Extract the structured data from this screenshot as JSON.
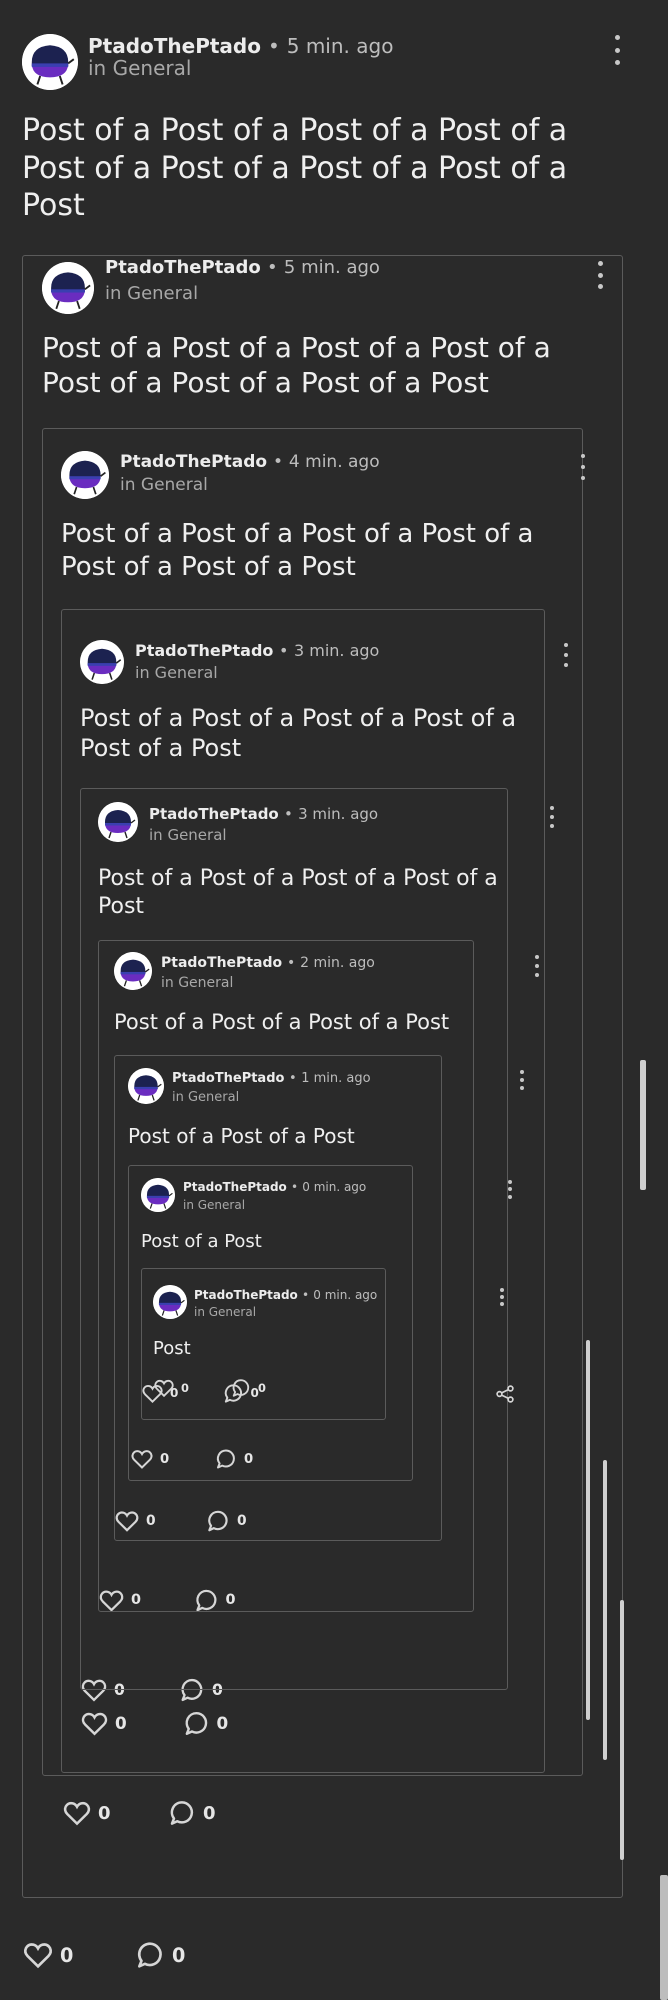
{
  "posts": [
    {
      "username": "PtadoThePtado",
      "separator": "•",
      "time": "5 min. ago",
      "community": "in General",
      "text": "Post of a Post of a Post of a Post of a Post of a Post of a Post of a Post of a Post",
      "likes": "0",
      "comments": "0"
    },
    {
      "username": "PtadoThePtado",
      "separator": "•",
      "time": "5 min. ago",
      "community": "in General",
      "text": "Post of a Post of a Post of a Post of a Post of a Post of a Post of a Post",
      "likes": "0",
      "comments": "0"
    },
    {
      "username": "PtadoThePtado",
      "separator": "•",
      "time": "4 min. ago",
      "community": "in General",
      "text": "Post of a Post of a Post of a Post of a Post of a Post of a Post",
      "likes": "0",
      "comments": "0"
    },
    {
      "username": "PtadoThePtado",
      "separator": "•",
      "time": "3 min. ago",
      "community": "in General",
      "text": "Post of a Post of a Post of a Post of a Post of a Post",
      "likes": "0",
      "comments": "0"
    },
    {
      "username": "PtadoThePtado",
      "separator": "•",
      "time": "3 min. ago",
      "community": "in General",
      "text": "Post of a Post of a Post of a Post of a Post",
      "likes": "0",
      "comments": "0"
    },
    {
      "username": "PtadoThePtado",
      "separator": "•",
      "time": "2 min. ago",
      "community": "in General",
      "text": "Post of a Post of a Post of a Post",
      "likes": "0",
      "comments": "0"
    },
    {
      "username": "PtadoThePtado",
      "separator": "•",
      "time": "1 min. ago",
      "community": "in General",
      "text": "Post of a Post of a Post",
      "likes": "0",
      "comments": "0"
    },
    {
      "username": "PtadoThePtado",
      "separator": "•",
      "time": "0 min. ago",
      "community": "in General",
      "text": "Post of a Post",
      "likes": "0",
      "comments": "0"
    },
    {
      "username": "PtadoThePtado",
      "separator": "•",
      "time": "0 min. ago",
      "community": "in General",
      "text": "Post",
      "likes": "0",
      "comments": "0"
    }
  ],
  "icons": {
    "avatar": "avatar-purple-blob",
    "menu": "kebab-menu-icon",
    "like": "heart-outline-icon",
    "comment": "speech-bubble-icon",
    "share": "share-icon"
  },
  "colors": {
    "background": "#2a2a2a",
    "card_border": "#5b5b5b",
    "avatar_purple": "#6a2cc0",
    "avatar_navy": "#1c2250"
  }
}
